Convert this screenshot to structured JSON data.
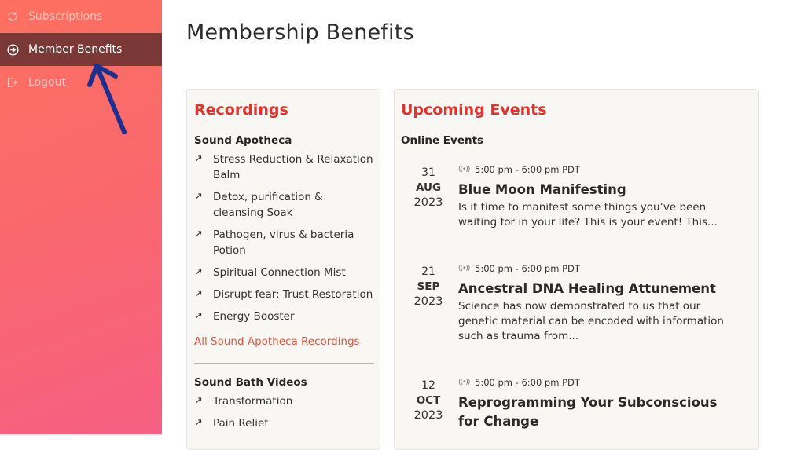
{
  "sidebar": {
    "items": [
      {
        "label": "Subscriptions",
        "icon": "refresh-circle-icon",
        "active": false
      },
      {
        "label": "Member Benefits",
        "icon": "arrow-right-circle-icon",
        "active": true
      },
      {
        "label": "Logout",
        "icon": "logout-icon",
        "active": false
      }
    ],
    "gradient": [
      "#fd7060",
      "#f65f82"
    ],
    "active_bg": "#7a3836"
  },
  "page": {
    "title": "Membership Benefits"
  },
  "recordings": {
    "title": "Recordings",
    "sections": [
      {
        "heading": "Sound Apotheca",
        "items": [
          "Stress Reduction & Relaxation Balm",
          "Detox, purification & cleansing Soak",
          "Pathogen, virus & bacteria Potion",
          "Spiritual Connection Mist",
          "Disrupt fear: Trust Restoration",
          "Energy Booster"
        ],
        "link": "All Sound Apotheca Recordings"
      },
      {
        "heading": "Sound Bath Videos",
        "items": [
          "Transformation",
          "Pain Relief"
        ]
      }
    ],
    "item_icon": "arrow-up-right-icon"
  },
  "events": {
    "title": "Upcoming Events",
    "subheading": "Online Events",
    "list": [
      {
        "day": "31",
        "month": "AUG",
        "year": "2023",
        "time": "5:00 pm - 6:00 pm PDT",
        "title": "Blue Moon Manifesting",
        "description": "Is it time to manifest some things you’ve been waiting for in your life?  This is your event!  This..."
      },
      {
        "day": "21",
        "month": "SEP",
        "year": "2023",
        "time": "5:00 pm - 6:00 pm PDT",
        "title": "Ancestral DNA Healing Attunement",
        "description": "Science has now demonstrated to us that our genetic material can be encoded with information such as trauma from..."
      },
      {
        "day": "12",
        "month": "OCT",
        "year": "2023",
        "time": "5:00 pm - 6:00 pm PDT",
        "title": "Reprogramming Your Subconscious for Change",
        "description": ""
      }
    ]
  },
  "colors": {
    "accent_red": "#e3322b",
    "link_orange": "#e2543c",
    "card_bg": "#f9f7f4",
    "annotation_arrow": "#1f2f8f"
  }
}
